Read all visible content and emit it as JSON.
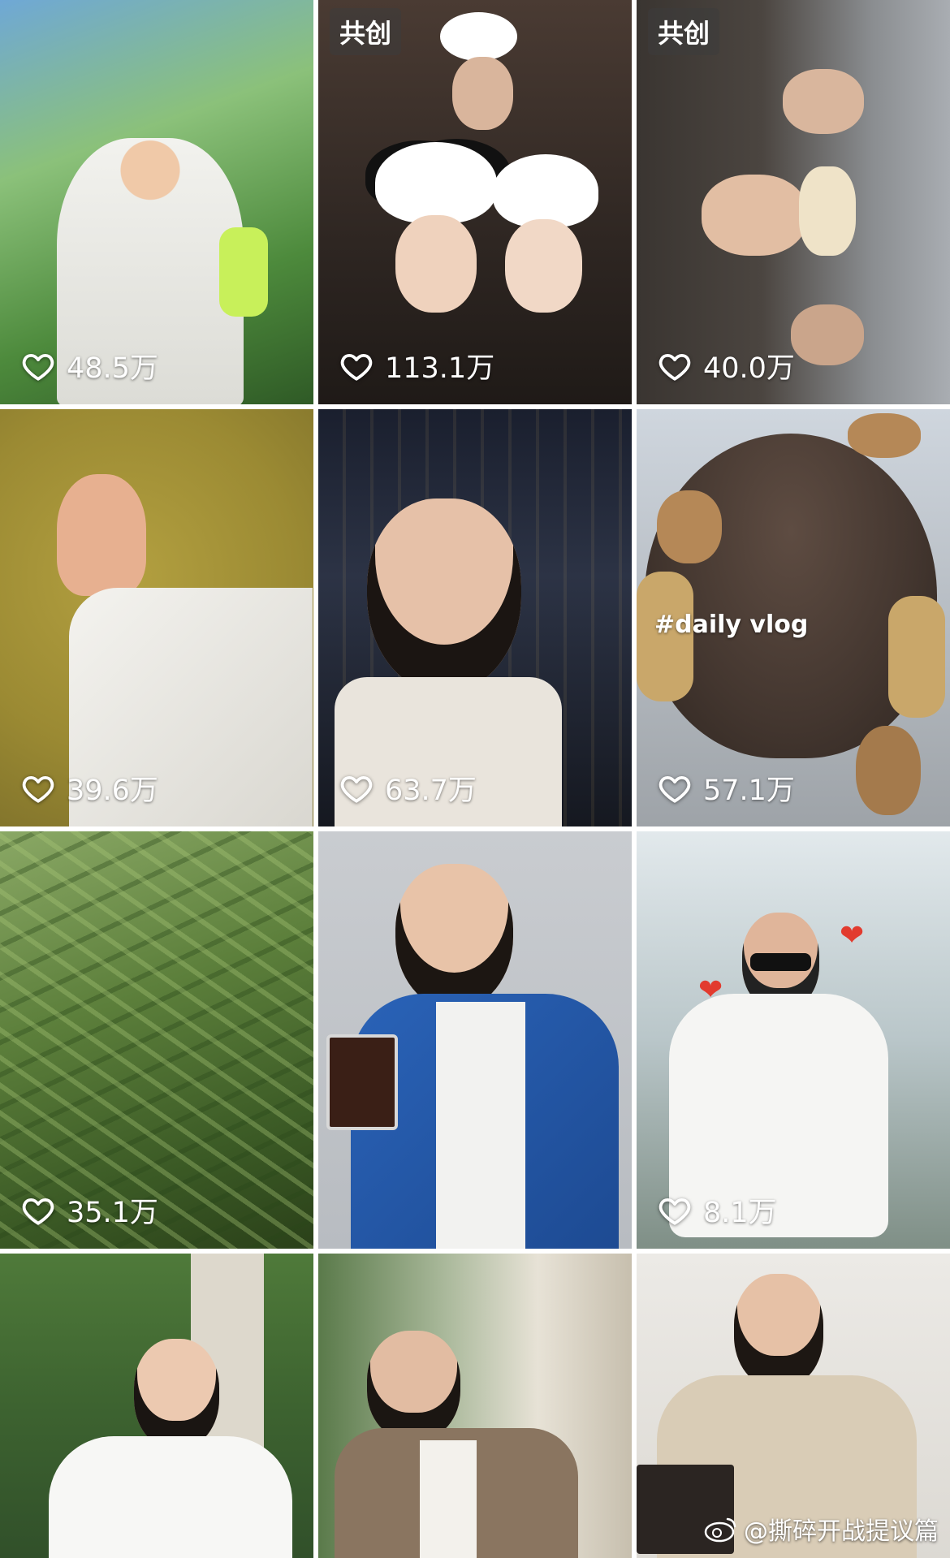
{
  "grid": {
    "rows": [
      [
        {
          "badge": "",
          "likes": "48.5万",
          "scene": "tropical-foliage-white-hoodie"
        },
        {
          "badge": "共创",
          "likes": "113.1万",
          "scene": "panda-hat-selfie"
        },
        {
          "badge": "共创",
          "likes": "40.0万",
          "scene": "three-guys-rotated"
        }
      ],
      [
        {
          "badge": "",
          "likes": "39.6万",
          "scene": "waving-hand-olive-wall"
        },
        {
          "badge": "",
          "likes": "63.7万",
          "scene": "night-city-selfie"
        },
        {
          "badge": "",
          "likes": "57.1万",
          "scene": "daily-vlog-teddy",
          "caption": "#daily vlog"
        }
      ],
      [
        {
          "badge": "",
          "likes": "35.1万",
          "scene": "bamboo-leaves"
        },
        {
          "badge": "",
          "likes": "",
          "scene": "blue-blazer-drink"
        },
        {
          "badge": "",
          "likes": "8.1万",
          "scene": "sunglasses-thumbs-up-hearts"
        }
      ],
      [
        {
          "badge": "",
          "likes": "",
          "scene": "white-shirt-tea-garden"
        },
        {
          "badge": "",
          "likes": "",
          "scene": "hand-on-cheek-window"
        },
        {
          "badge": "",
          "likes": "",
          "scene": "reading-book-beige-shirt"
        }
      ]
    ]
  },
  "watermark": {
    "text": "@撕碎开战提议篇",
    "icon": "weibo-icon"
  },
  "colors": {
    "like_text": "#ffffff",
    "badge_bg": "#4a4a4a"
  }
}
